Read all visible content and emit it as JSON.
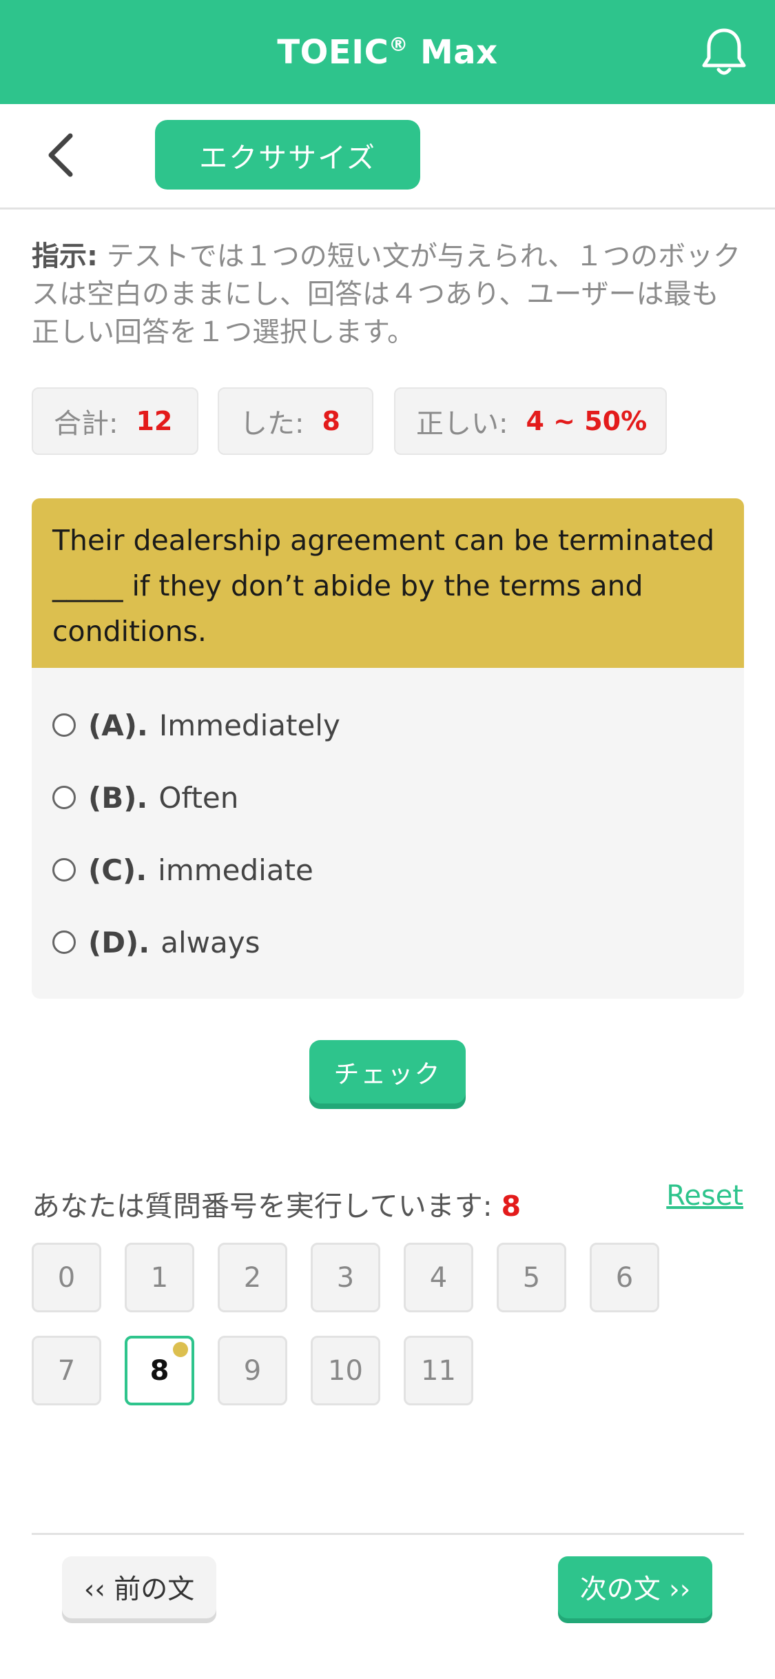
{
  "header": {
    "title": "TOEIC",
    "title_mark": "®",
    "title_suffix": " Max"
  },
  "subbar": {
    "tab_label": "エクササイズ"
  },
  "instructions": {
    "label": "指示:",
    "text": " テストでは１つの短い文が与えられ、１つのボックスは空白のままにし、回答は４つあり、ユーザーは最も正しい回答を１つ選択します。"
  },
  "stats": {
    "total_label": "合計:",
    "total_value": "12",
    "done_label": "した:",
    "done_value": "8",
    "correct_label": "正しい:",
    "correct_value": "4 ~ 50%"
  },
  "question": {
    "text": "Their dealership agreement can be terminated _____ if they don’t abide by the terms and conditions.",
    "options": [
      {
        "key": "(A).",
        "text": "Immediately"
      },
      {
        "key": "(B).",
        "text": "Often"
      },
      {
        "key": "(C).",
        "text": "immediate"
      },
      {
        "key": "(D).",
        "text": "always"
      }
    ]
  },
  "check_label": "チェック",
  "progress": {
    "label": "あなたは質問番号を実行しています:",
    "current": "8",
    "reset_label": "Reset"
  },
  "questions": [
    "0",
    "1",
    "2",
    "3",
    "4",
    "5",
    "6",
    "7",
    "8",
    "9",
    "10",
    "11"
  ],
  "nav": {
    "prev_label": "‹‹ 前の文",
    "next_label": "次の文 ››"
  },
  "colors": {
    "brand": "#2ec48c",
    "question_bg": "#dcbf4f",
    "highlight": "#e31b1b"
  }
}
